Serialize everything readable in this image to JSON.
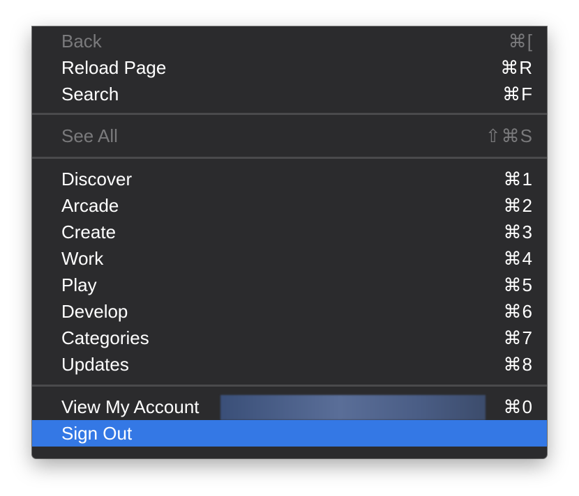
{
  "menu": {
    "group1": [
      {
        "label": "Back",
        "shortcut": "⌘[",
        "disabled": true
      },
      {
        "label": "Reload Page",
        "shortcut": "⌘R"
      },
      {
        "label": "Search",
        "shortcut": "⌘F"
      }
    ],
    "group2": [
      {
        "label": "See All",
        "shortcut": "⇧⌘S",
        "disabled": true
      }
    ],
    "group3": [
      {
        "label": "Discover",
        "shortcut": "⌘1"
      },
      {
        "label": "Arcade",
        "shortcut": "⌘2"
      },
      {
        "label": "Create",
        "shortcut": "⌘3"
      },
      {
        "label": "Work",
        "shortcut": "⌘4"
      },
      {
        "label": "Play",
        "shortcut": "⌘5"
      },
      {
        "label": "Develop",
        "shortcut": "⌘6"
      },
      {
        "label": "Categories",
        "shortcut": "⌘7"
      },
      {
        "label": "Updates",
        "shortcut": "⌘8"
      }
    ],
    "group4": [
      {
        "label": "View My Account",
        "shortcut": "⌘0"
      },
      {
        "label": "Sign Out",
        "shortcut": "",
        "highlighted": true
      }
    ]
  },
  "colors": {
    "menu_bg": "#2b2b2d",
    "highlight": "#3478e5",
    "disabled_text": "#7a7a7c"
  }
}
